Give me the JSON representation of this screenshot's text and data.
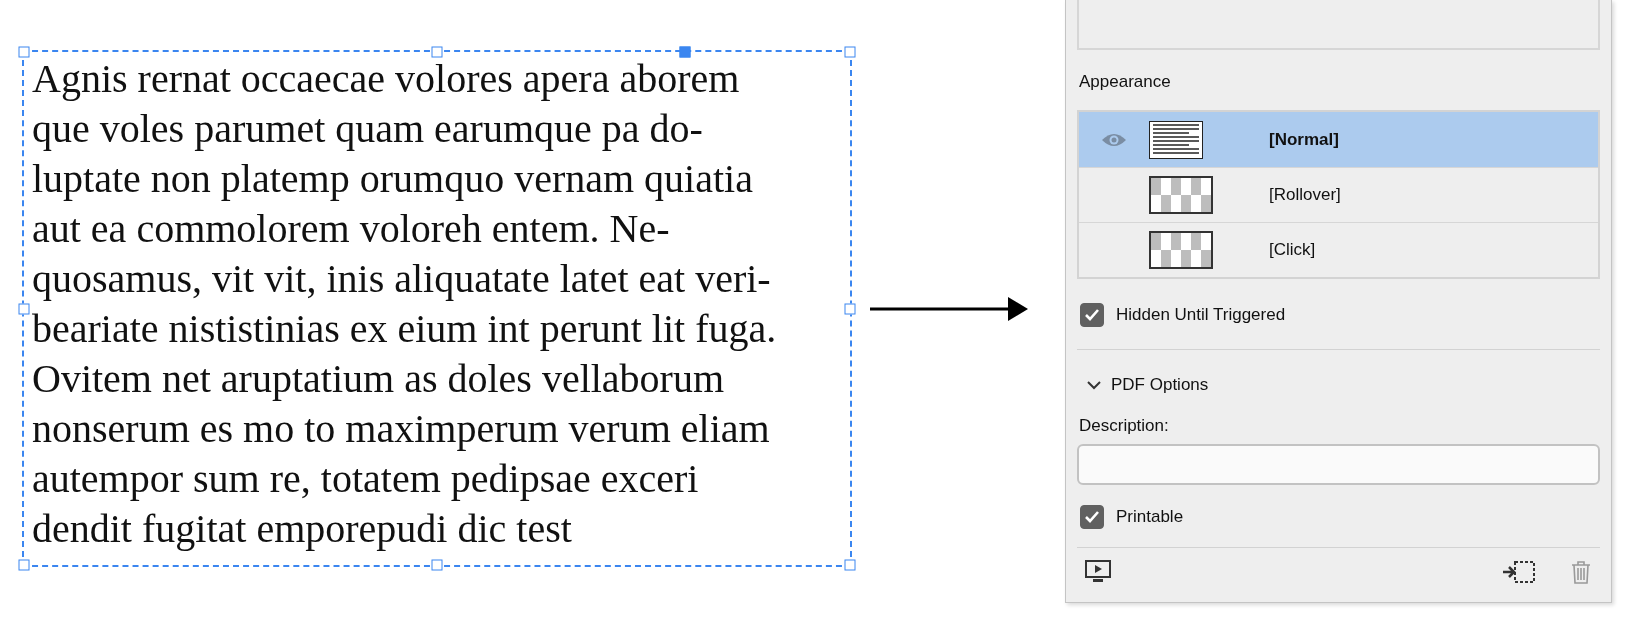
{
  "text_frame": {
    "lines": [
      "Agnis rernat occaecae volores apera aborem",
      "que voles parumet quam earumque pa do-",
      "luptate non platemp orumquo vernam quiatia",
      "aut ea commolorem voloreh entem. Ne-",
      "quosamus, vit vit, inis aliquatate latet eat veri-",
      "beariate nististinias ex eium int perunt lit fuga.",
      "Ovitem net aruptatium as doles vellaborum",
      "nonserum es mo to maximperum verum eliam",
      "autempor sum re, totatem pedipsae exceri",
      "dendit fugitat emporepudi dic test"
    ]
  },
  "panel": {
    "appearance": {
      "title": "Appearance",
      "states": [
        {
          "label": "[Normal]",
          "selected": true,
          "visible": true,
          "kind": "text"
        },
        {
          "label": "[Rollover]",
          "selected": false,
          "visible": false,
          "kind": "empty"
        },
        {
          "label": "[Click]",
          "selected": false,
          "visible": false,
          "kind": "empty"
        }
      ]
    },
    "hidden_until_triggered": {
      "label": "Hidden Until Triggered",
      "checked": true
    },
    "pdf_options": {
      "title": "PDF Options",
      "expanded": true,
      "description_label": "Description:",
      "printable": {
        "label": "Printable",
        "checked": true
      }
    }
  }
}
